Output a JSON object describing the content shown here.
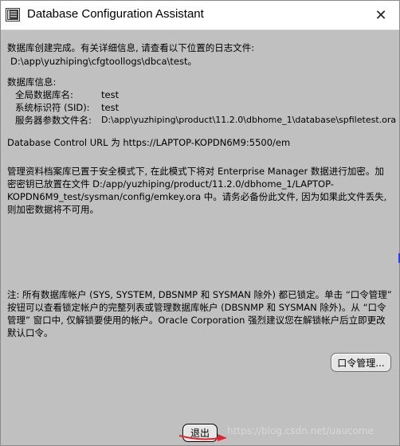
{
  "window": {
    "title": "Database Configuration Assistant"
  },
  "titlebar": {
    "close_glyph": "✕"
  },
  "intro": {
    "line1": "数据库创建完成。有关详细信息, 请查看以下位置的日志文件:",
    "log_path": "D:\\app\\yuzhiping\\cfgtoollogs\\dbca\\test。"
  },
  "db_info": {
    "heading": "数据库信息:",
    "rows": [
      {
        "label": "全局数据库名:",
        "value": "test"
      },
      {
        "label": "系统标识符 (SID):",
        "value": "test"
      },
      {
        "label": "服务器参数文件名:",
        "value": "D:\\app\\yuzhiping\\product\\11.2.0\\dbhome_1\\database\\spfiletest.ora"
      }
    ]
  },
  "control_url": "Database Control URL 为 https://LAPTOP-KOPDN6M9:5500/em",
  "secure_mode": "管理资料档案库已置于安全模式下, 在此模式下将对 Enterprise Manager 数据进行加密。加密密钥已放置在文件 D:/app/yuzhiping/product/11.2.0/dbhome_1/LAPTOP-KOPDN6M9_test/sysman/config/emkey.ora 中。请务必备份此文件, 因为如果此文件丢失, 则加密数据将不可用。",
  "note": "注: 所有数据库帐户 (SYS, SYSTEM, DBSNMP 和 SYSMAN 除外) 都已锁定。单击 “口令管理” 按钮可以查看锁定帐户的完整列表或管理数据库帐户 (DBSNMP 和 SYSMAN 除外)。从 “口令管理” 窗口中, 仅解锁要使用的帐户。Oracle Corporation 强烈建议您在解锁帐户后立即更改默认口令。",
  "buttons": {
    "password_mgmt": "口令管理...",
    "exit": "退出"
  },
  "watermark": "https://blog.csdn.net/uaucome",
  "colors": {
    "background": "#c0c0c0",
    "arrow": "#e0262b"
  }
}
